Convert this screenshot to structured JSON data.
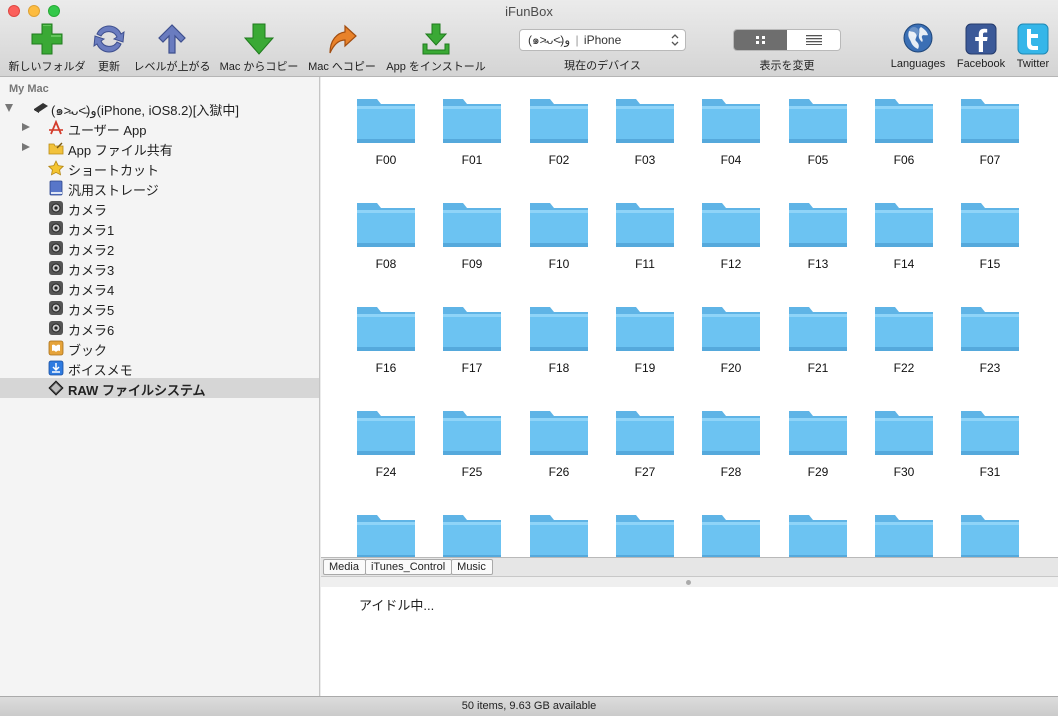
{
  "window": {
    "title": "iFunBox"
  },
  "toolbar": {
    "new_folder": "新しいフォルダ",
    "refresh": "更新",
    "up_level": "レベルが上がる",
    "copy_to_mac": "Mac からコピー",
    "copy_from_mac": "Mac へコピー",
    "install_app": "App をインストール",
    "device_name": "(๑˃̵ᴗ˂̵)و",
    "device_model": "iPhone",
    "device_caption": "現在のデバイス",
    "view_caption": "表示を変更",
    "languages": "Languages",
    "facebook": "Facebook",
    "twitter": "Twitter"
  },
  "sidebar": {
    "header": "My Mac",
    "device_row": "(๑˃̵ᴗ˂̵)و(iPhone, iOS8.2)[入獄中]",
    "items": [
      {
        "label": "ユーザー App",
        "icon": "app-store-icon"
      },
      {
        "label": "App ファイル共有",
        "icon": "folder-share-icon"
      },
      {
        "label": "ショートカット",
        "icon": "star-icon"
      },
      {
        "label": "汎用ストレージ",
        "icon": "book-icon"
      },
      {
        "label": "カメラ",
        "icon": "camera-icon"
      },
      {
        "label": "カメラ1",
        "icon": "camera-icon"
      },
      {
        "label": "カメラ2",
        "icon": "camera-icon"
      },
      {
        "label": "カメラ3",
        "icon": "camera-icon"
      },
      {
        "label": "カメラ4",
        "icon": "camera-icon"
      },
      {
        "label": "カメラ5",
        "icon": "camera-icon"
      },
      {
        "label": "カメラ6",
        "icon": "camera-icon"
      },
      {
        "label": "ブック",
        "icon": "ibooks-icon"
      },
      {
        "label": "ボイスメモ",
        "icon": "voice-memo-icon"
      },
      {
        "label": "RAW ファイルシステム",
        "icon": "raw-fs-icon"
      }
    ]
  },
  "folders": [
    "F00",
    "F01",
    "F02",
    "F03",
    "F04",
    "F05",
    "F06",
    "F07",
    "F08",
    "F09",
    "F10",
    "F11",
    "F12",
    "F13",
    "F14",
    "F15",
    "F16",
    "F17",
    "F18",
    "F19",
    "F20",
    "F21",
    "F22",
    "F23",
    "F24",
    "F25",
    "F26",
    "F27",
    "F28",
    "F29",
    "F30",
    "F31",
    "",
    "",
    "",
    "",
    "",
    "",
    "",
    ""
  ],
  "breadcrumb": [
    "Media",
    "iTunes_Control",
    "Music"
  ],
  "log": {
    "message": "アイドル中..."
  },
  "status": {
    "text": "50 items, 9.63 GB available"
  },
  "colors": {
    "folder_blue": "#6cc3f2",
    "selected_row": "#d6d6d6"
  }
}
